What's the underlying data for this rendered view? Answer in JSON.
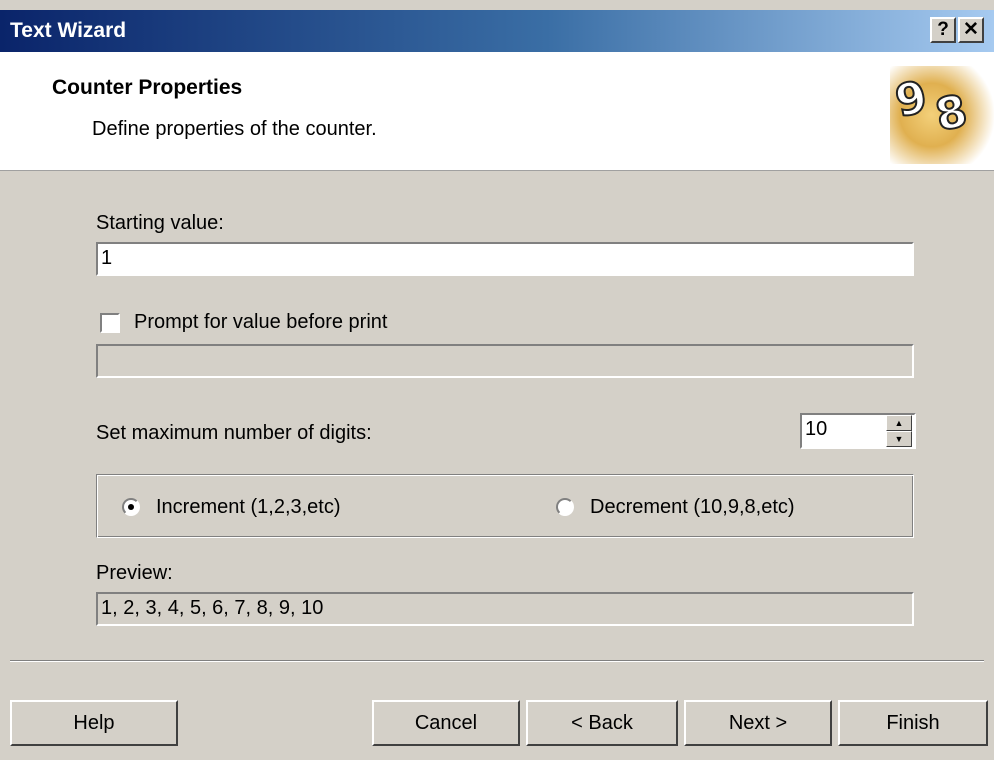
{
  "window": {
    "title": "Text Wizard",
    "help_btn": "?",
    "close_btn": "✕"
  },
  "header": {
    "title": "Counter Properties",
    "subtitle": "Define properties of the counter.",
    "logo_digits": [
      "9",
      "8"
    ]
  },
  "form": {
    "starting_value_label": "Starting value:",
    "starting_value": "1",
    "prompt_label": "Prompt for value before print",
    "prompt_checked": false,
    "prompt_value": "",
    "max_digits_label": "Set maximum number of digits:",
    "max_digits": "10",
    "increment_label": "Increment  (1,2,3,etc)",
    "decrement_label": "Decrement  (10,9,8,etc)",
    "selected_direction": "increment",
    "preview_label": "Preview:",
    "preview_value": "1, 2, 3, 4, 5, 6, 7, 8, 9, 10"
  },
  "buttons": {
    "help": "Help",
    "cancel": "Cancel",
    "back": "< Back",
    "next": "Next >",
    "finish": "Finish"
  }
}
